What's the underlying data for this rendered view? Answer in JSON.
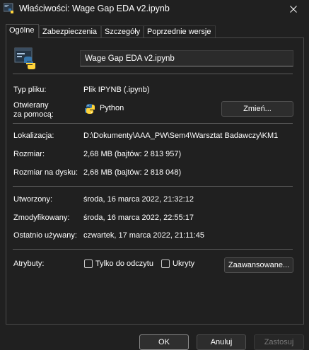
{
  "window": {
    "title": "Właściwości: Wage Gap EDA v2.ipynb"
  },
  "tabs": [
    {
      "label": "Ogólne"
    },
    {
      "label": "Zabezpieczenia"
    },
    {
      "label": "Szczegóły"
    },
    {
      "label": "Poprzednie wersje"
    }
  ],
  "general": {
    "file_name": "Wage Gap EDA v2.ipynb",
    "file_type_label": "Typ pliku:",
    "file_type_value": "Plik IPYNB (.ipynb)",
    "opens_with_label_1": "Otwierany",
    "opens_with_label_2": "za pomocą:",
    "opens_with_value": "Python",
    "change_button": "Zmień...",
    "location_label": "Lokalizacja:",
    "location_value": "D:\\Dokumenty\\AAA_PW\\Sem4\\Warsztat Badawczy\\KM1",
    "size_label": "Rozmiar:",
    "size_value": "2,68 MB (bajtów: 2 813 957)",
    "size_on_disk_label": "Rozmiar na dysku:",
    "size_on_disk_value": "2,68 MB (bajtów: 2 818 048)",
    "created_label": "Utworzony:",
    "created_value": "środa, 16 marca 2022, 21:32:12",
    "modified_label": "Zmodyfikowany:",
    "modified_value": "środa, 16 marca 2022, 22:55:17",
    "accessed_label": "Ostatnio używany:",
    "accessed_value": "czwartek, 17 marca 2022, 21:11:45",
    "attributes_label": "Atrybuty:",
    "readonly_label": "Tylko do odczytu",
    "hidden_label": "Ukryty",
    "advanced_button": "Zaawansowane..."
  },
  "footer": {
    "ok": "OK",
    "cancel": "Anuluj",
    "apply": "Zastosuj"
  },
  "icons": {
    "title": "notebook-python-icon",
    "file": "notebook-python-icon",
    "app": "python-icon",
    "close": "close-icon"
  }
}
